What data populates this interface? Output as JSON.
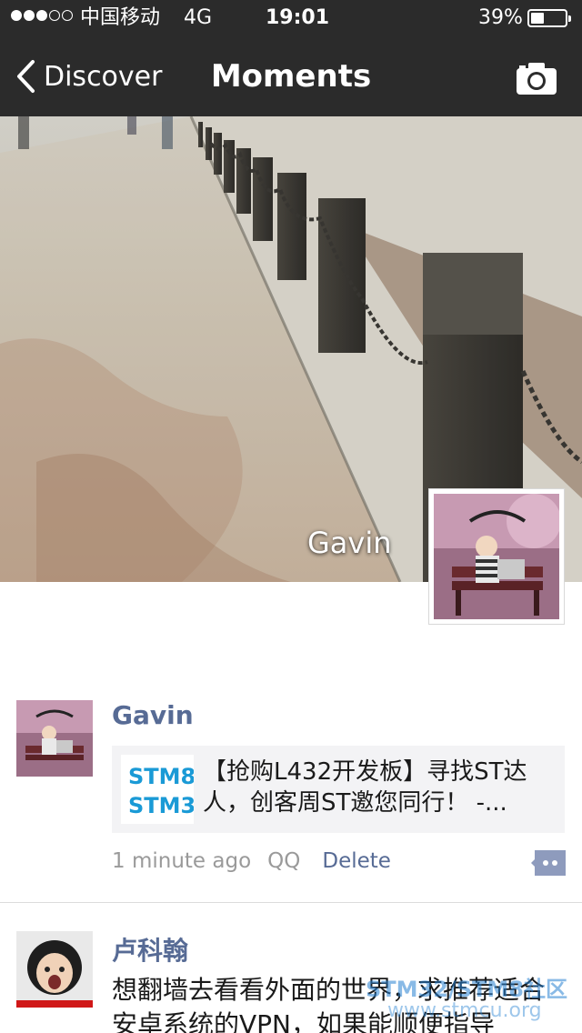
{
  "status_bar": {
    "carrier": "中国移动",
    "network": "4G",
    "time": "19:01",
    "battery_percent": "39%",
    "battery_level": 0.39
  },
  "nav": {
    "back_label": "Discover",
    "title": "Moments"
  },
  "cover": {
    "user_name": "Gavin"
  },
  "posts": [
    {
      "author": "Gavin",
      "share": {
        "thumb_lines": [
          "STM8",
          "STM3"
        ],
        "text": "【抢购L432开发板】寻找ST达人，创客周ST邀您同行！ -..."
      },
      "time": "1 minute ago",
      "source": "QQ",
      "delete_label": "Delete"
    },
    {
      "author": "卢科翰",
      "text": "想翻墙去看看外面的世界，求推荐适合安卓系统的VPN，如果能顺便指导"
    }
  ],
  "watermark": {
    "line1": "STM32/STM8社区",
    "line2": "www.stmcu.org"
  },
  "colors": {
    "bar_bg": "#2b2b2b",
    "link_blue": "#576b95",
    "card_bg": "#f3f3f5"
  }
}
